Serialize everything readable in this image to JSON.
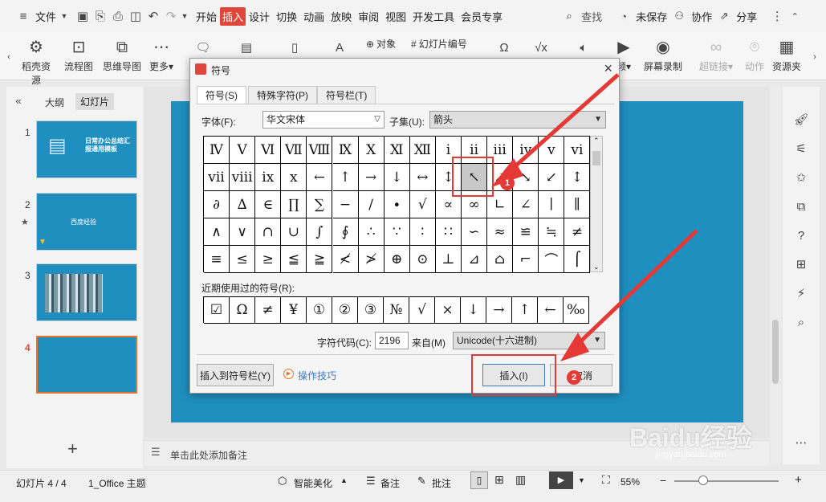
{
  "menubar": {
    "file": "文件",
    "tabs": [
      "开始",
      "插入",
      "设计",
      "切换",
      "动画",
      "放映",
      "审阅",
      "视图",
      "开发工具",
      "会员专享"
    ],
    "active_tab": "插入",
    "search": "查找",
    "unsaved": "未保存",
    "collab": "协作",
    "share": "分享"
  },
  "ribbon": {
    "items": [
      {
        "label": "稻壳资源",
        "icon": "resource-icon"
      },
      {
        "label": "流程图",
        "icon": "flowchart-icon"
      },
      {
        "label": "思维导图",
        "icon": "mindmap-icon"
      },
      {
        "label": "更多",
        "icon": "more-icon"
      },
      {
        "label": "对象",
        "icon": "object-icon"
      },
      {
        "label": "幻灯片编号",
        "icon": "slide-number-icon"
      },
      {
        "label": "频",
        "icon": "video-icon"
      },
      {
        "label": "屏幕录制",
        "icon": "screen-record-icon"
      },
      {
        "label": "超链接",
        "icon": "hyperlink-icon"
      },
      {
        "label": "动作",
        "icon": "action-icon"
      },
      {
        "label": "资源夹",
        "icon": "resource-folder-icon"
      }
    ]
  },
  "leftpanel": {
    "tab_outline": "大纲",
    "tab_slides": "幻灯片",
    "slides": [
      {
        "num": "1",
        "text": "日常办公总结汇报通用模板"
      },
      {
        "num": "2",
        "text": "西度经验"
      },
      {
        "num": "3",
        "text": ""
      },
      {
        "num": "4",
        "text": ""
      }
    ],
    "add": "+"
  },
  "notes_placeholder": "单击此处添加备注",
  "dialog": {
    "title": "符号",
    "tabs": [
      "符号(S)",
      "特殊字符(P)",
      "符号栏(T)"
    ],
    "font_label": "字体(F):",
    "font_value": "华文宋体",
    "subset_label": "子集(U):",
    "subset_value": "箭头",
    "symbols": [
      [
        "Ⅳ",
        "Ⅴ",
        "Ⅵ",
        "Ⅶ",
        "Ⅷ",
        "Ⅸ",
        "Ⅹ",
        "Ⅺ",
        "Ⅻ",
        "ⅰ",
        "ⅱ",
        "ⅲ",
        "ⅳ",
        "ⅴ",
        "ⅵ"
      ],
      [
        "ⅶ",
        "ⅷ",
        "ⅸ",
        "ⅹ",
        "←",
        "↑",
        "→",
        "↓",
        "↔",
        "↕",
        "↖",
        "↗",
        "↘",
        "↙",
        "↕"
      ],
      [
        "∂",
        "∆",
        "∈",
        "∏",
        "∑",
        "−",
        "∕",
        "∙",
        "√",
        "∝",
        "∞",
        "∟",
        "∠",
        "∣",
        "∥"
      ],
      [
        "∧",
        "∨",
        "∩",
        "∪",
        "∫",
        "∮",
        "∴",
        "∵",
        "∶",
        "∷",
        "∽",
        "≈",
        "≌",
        "≒",
        "≠"
      ],
      [
        "≡",
        "≤",
        "≥",
        "≦",
        "≧",
        "≮",
        "≯",
        "⊕",
        "⊙",
        "⊥",
        "⊿",
        "⌂",
        "⌐",
        "⌒",
        "⌠"
      ]
    ],
    "recent_label": "近期使用过的符号(R):",
    "recent": [
      "☑",
      "Ω",
      "≠",
      "¥",
      "①",
      "②",
      "③",
      "№",
      "√",
      "×",
      "↓",
      "→",
      "↑",
      "←",
      "‰"
    ],
    "code_label": "字符代码(C):",
    "code_value": "2196",
    "from_label": "来自(M)",
    "from_value": "Unicode(十六进制)",
    "btn_insert_bar": "插入到符号栏(Y)",
    "tips": "操作技巧",
    "btn_insert": "插入(I)",
    "btn_cancel": "取消"
  },
  "annotations": {
    "badge1": "1",
    "badge2": "2"
  },
  "statusbar": {
    "slide_info": "幻灯片 4 / 4",
    "theme": "1_Office 主题",
    "beautify": "智能美化",
    "notes": "备注",
    "comment": "批注",
    "zoom": "55%"
  },
  "watermark": {
    "text": "Baidu经验",
    "sub": "jingyan.baidu.com"
  },
  "colors": {
    "accent": "#e0473c",
    "slide_blue": "#1f8fbf",
    "annotation_red": "#e53935"
  }
}
